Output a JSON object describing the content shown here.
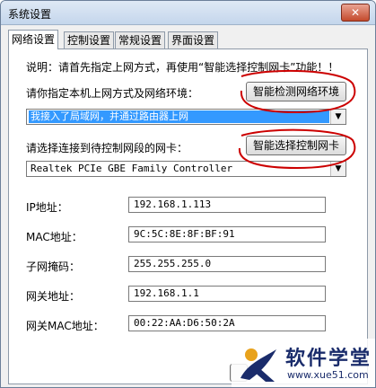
{
  "window": {
    "title": "系统设置",
    "close_symbol": "✕"
  },
  "tabs": [
    {
      "label": "网络设置",
      "active": true
    },
    {
      "label": "控制设置",
      "active": false
    },
    {
      "label": "常规设置",
      "active": false
    },
    {
      "label": "界面设置",
      "active": false
    }
  ],
  "network": {
    "note": "说明：请首先指定上网方式，再使用“智能选择控制网卡”功能！！",
    "env_label": "请你指定本机上网方式及网络环境：",
    "detect_button": "智能检测网络环境",
    "env_selected": "我接入了局域网，并通过路由器上网",
    "nic_label": "请选择连接到待控制网段的网卡：",
    "nic_button": "智能选择控制网卡",
    "nic_selected": "Realtek PCIe GBE Family Controller",
    "fields": [
      {
        "label": "IP地址：",
        "value": "192.168.1.113"
      },
      {
        "label": "MAC地址：",
        "value": "9C:5C:8E:8F:BF:91"
      },
      {
        "label": "子网掩码：",
        "value": "255.255.255.0"
      },
      {
        "label": "网关地址：",
        "value": "192.168.1.1"
      },
      {
        "label": "网关MAC地址：",
        "value": "00:22:AA:D6:50:2A"
      }
    ]
  },
  "watermark": {
    "title": "软件学堂",
    "url": "www.xue51.com"
  },
  "colors": {
    "selection": "#3399ff",
    "annotation": "#cc0000",
    "brand": "#1a2c6b"
  }
}
